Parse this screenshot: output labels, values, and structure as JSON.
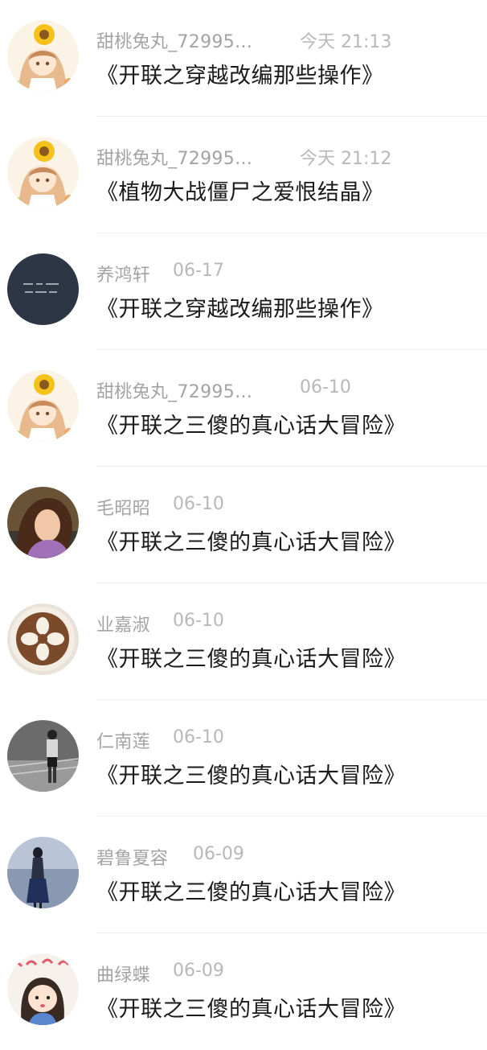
{
  "messages": [
    {
      "name": "甜桃兔丸_72995…",
      "time": "今天 21:13",
      "text": "《开联之穿越改编那些操作》",
      "avatar": "sunflower-girl-icon"
    },
    {
      "name": "甜桃兔丸_72995…",
      "time": "今天 21:12",
      "text": "《植物大战僵尸之爱恨结晶》",
      "avatar": "sunflower-girl-icon"
    },
    {
      "name": "养鸿轩",
      "time": "06-17",
      "text": "《开联之穿越改编那些操作》",
      "avatar": "dark-text-avatar-icon"
    },
    {
      "name": "甜桃兔丸_72995…",
      "time": "06-10",
      "text": "《开联之三傻的真心话大冒险》",
      "avatar": "sunflower-girl-icon"
    },
    {
      "name": "毛昭昭",
      "time": "06-10",
      "text": "《开联之三傻的真心话大冒险》",
      "avatar": "girl-photo-icon"
    },
    {
      "name": "业嘉淑",
      "time": "06-10",
      "text": "《开联之三傻的真心话大冒险》",
      "avatar": "latte-art-icon"
    },
    {
      "name": "仁南莲",
      "time": "06-10",
      "text": "《开联之三傻的真心话大冒险》",
      "avatar": "bw-photo-icon"
    },
    {
      "name": "碧鲁夏容",
      "time": "06-09",
      "text": "《开联之三傻的真心话大冒险》",
      "avatar": "seaside-girl-icon"
    },
    {
      "name": "曲绿蝶",
      "time": "06-09",
      "text": "《开联之三傻的真心话大冒险》",
      "avatar": "cartoon-girl-icon"
    }
  ]
}
